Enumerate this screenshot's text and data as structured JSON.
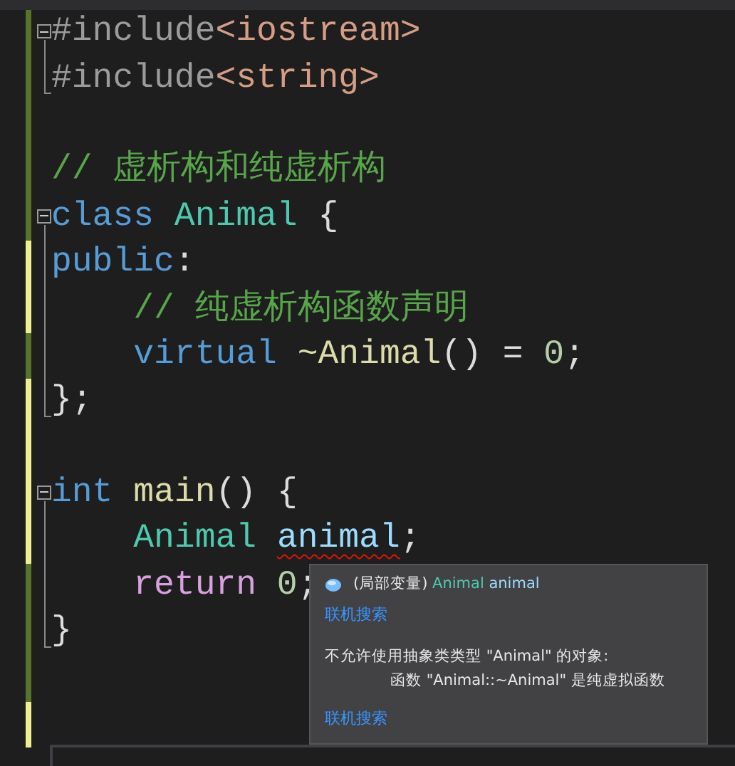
{
  "editor": {
    "lines": [
      {
        "modified": false,
        "expanded": true,
        "tokens": [
          {
            "kind": "preprocessor",
            "text": "#include"
          },
          {
            "kind": "include-path",
            "text": "<iostream>"
          }
        ],
        "children": [
          {
            "modified": false,
            "tokens": [
              {
                "kind": "preprocessor",
                "text": "#include"
              },
              {
                "kind": "include-path",
                "text": "<string>"
              }
            ]
          }
        ]
      },
      {
        "modified": false
      },
      {
        "modified": false,
        "tokens": [
          {
            "kind": "comment",
            "text": "// 虚析构和纯虚析构"
          }
        ]
      },
      {
        "modified": false,
        "expanded": true,
        "tokens": [
          {
            "kind": "keyword",
            "text": "class"
          },
          {
            "kind": "type",
            "text": " Animal"
          },
          {
            "kind": "plain",
            "text": " {"
          }
        ],
        "children": [
          {
            "modified": true,
            "tokens": [
              {
                "kind": "keyword",
                "text": "public"
              },
              {
                "kind": "plain",
                "text": ":"
              }
            ]
          },
          {
            "modified": true,
            "tokens": [
              {
                "kind": "comment",
                "text": "    // 纯虚析构函数声明"
              }
            ]
          },
          {
            "modified": false,
            "tokens": [
              {
                "kind": "keyword",
                "text": "    virtual"
              },
              {
                "kind": "function",
                "text": " ~Animal"
              },
              {
                "kind": "plain",
                "text": "() = "
              },
              {
                "kind": "number",
                "text": "0"
              },
              {
                "kind": "plain",
                "text": ";"
              }
            ]
          },
          {
            "modified": true,
            "tokens": [
              {
                "kind": "plain",
                "text": "};"
              }
            ]
          }
        ]
      },
      {
        "modified": true
      },
      {
        "modified": true,
        "expanded": true,
        "tokens": [
          {
            "kind": "keyword",
            "text": "int"
          },
          {
            "kind": "function",
            "text": " main"
          },
          {
            "kind": "plain",
            "text": "() {"
          }
        ],
        "children": [
          {
            "modified": true,
            "tokens": [
              {
                "kind": "type",
                "text": "    Animal "
              },
              {
                "kind": "variable",
                "text": "animal",
                "error": true
              },
              {
                "kind": "plain",
                "text": ";"
              }
            ]
          },
          {
            "modified": false,
            "tokens": [
              {
                "kind": "control",
                "text": "    return"
              },
              {
                "kind": "number",
                "text": " 0"
              },
              {
                "kind": "plain",
                "text": ";"
              }
            ]
          },
          {
            "modified": false,
            "tokens": [
              {
                "kind": "plain",
                "text": "}"
              }
            ]
          }
        ]
      },
      {
        "modified": false
      },
      {
        "modified": true
      }
    ]
  },
  "tooltip": {
    "signature": [
      {
        "kind": "plain",
        "text": "(局部变量) "
      },
      {
        "kind": "type",
        "text": "Animal"
      },
      {
        "kind": "variable",
        "text": " animal"
      }
    ],
    "search_link_1": "联机搜索",
    "error_lines": [
      "不允许使用抽象类类型 \"Animal\" 的对象:",
      "函数 \"Animal::~Animal\" 是纯虚拟函数"
    ],
    "search_link_2": "联机搜索"
  }
}
